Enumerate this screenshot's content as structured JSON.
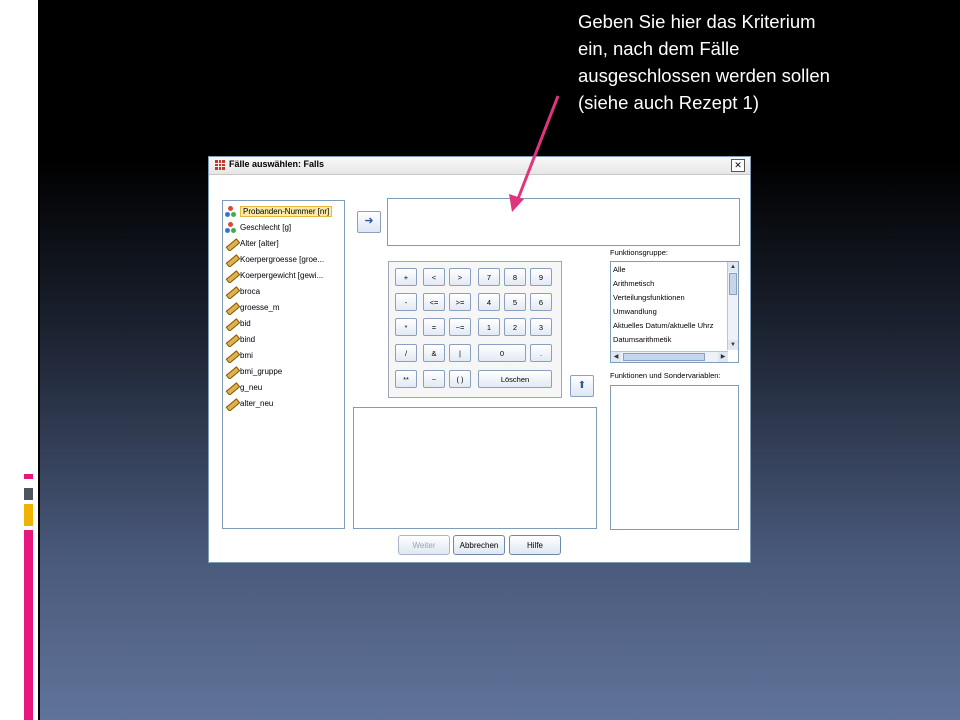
{
  "callout": {
    "line1": "Geben Sie hier das Kriterium",
    "line2": "ein, nach dem Fälle",
    "line3": "ausgeschlossen werden sollen",
    "line4": "(siehe auch Rezept 1)"
  },
  "dialog": {
    "title": "Fälle auswählen: Falls",
    "close_label": "✕",
    "variables": [
      {
        "label": "Probanden-Nummer [nr]",
        "type": "nominal",
        "selected": true
      },
      {
        "label": "Geschlecht [g]",
        "type": "nominal"
      },
      {
        "label": "Alter [alter]",
        "type": "scale"
      },
      {
        "label": "Koerpergroesse [groe...",
        "type": "scale"
      },
      {
        "label": "Koerpergewicht [gewi...",
        "type": "scale"
      },
      {
        "label": "broca",
        "type": "scale"
      },
      {
        "label": "groesse_m",
        "type": "scale"
      },
      {
        "label": "bid",
        "type": "scale"
      },
      {
        "label": "bind",
        "type": "scale"
      },
      {
        "label": "bmi",
        "type": "scale"
      },
      {
        "label": "bmi_gruppe",
        "type": "scale"
      },
      {
        "label": "g_neu",
        "type": "scale"
      },
      {
        "label": "alter_neu",
        "type": "scale"
      }
    ],
    "move_icon": "arrow-right-icon",
    "up_icon": "arrow-up-icon",
    "keypad": {
      "plus": "+",
      "lt": "<",
      "gt": ">",
      "k7": "7",
      "k8": "8",
      "k9": "9",
      "minus": "-",
      "le": "<=",
      "ge": ">=",
      "k4": "4",
      "k5": "5",
      "k6": "6",
      "mul": "*",
      "eq": "=",
      "ne": "~=",
      "k1": "1",
      "k2": "2",
      "k3": "3",
      "div": "/",
      "and": "&",
      "or": "|",
      "k0": "0",
      "dot": ".",
      "pow": "**",
      "not": "~",
      "paren": "( )",
      "clear": "Löschen"
    },
    "function_group_label": "Funktionsgruppe:",
    "function_groups": [
      "Alle",
      "Arithmetisch",
      "Verteilungsfunktionen",
      "Umwandlung",
      "Aktuelles Datum/aktuelle Uhrz",
      "Datumsarithmetik"
    ],
    "functions_label": "Funktionen und Sondervariablen:",
    "buttons": {
      "continue": "Weiter",
      "cancel": "Abbrechen",
      "help": "Hilfe"
    }
  },
  "colors": {
    "arrow": "#e0357e",
    "accent_pink": "#e8177d",
    "accent_yellow": "#f0b400",
    "accent_gray": "#4a5560"
  }
}
